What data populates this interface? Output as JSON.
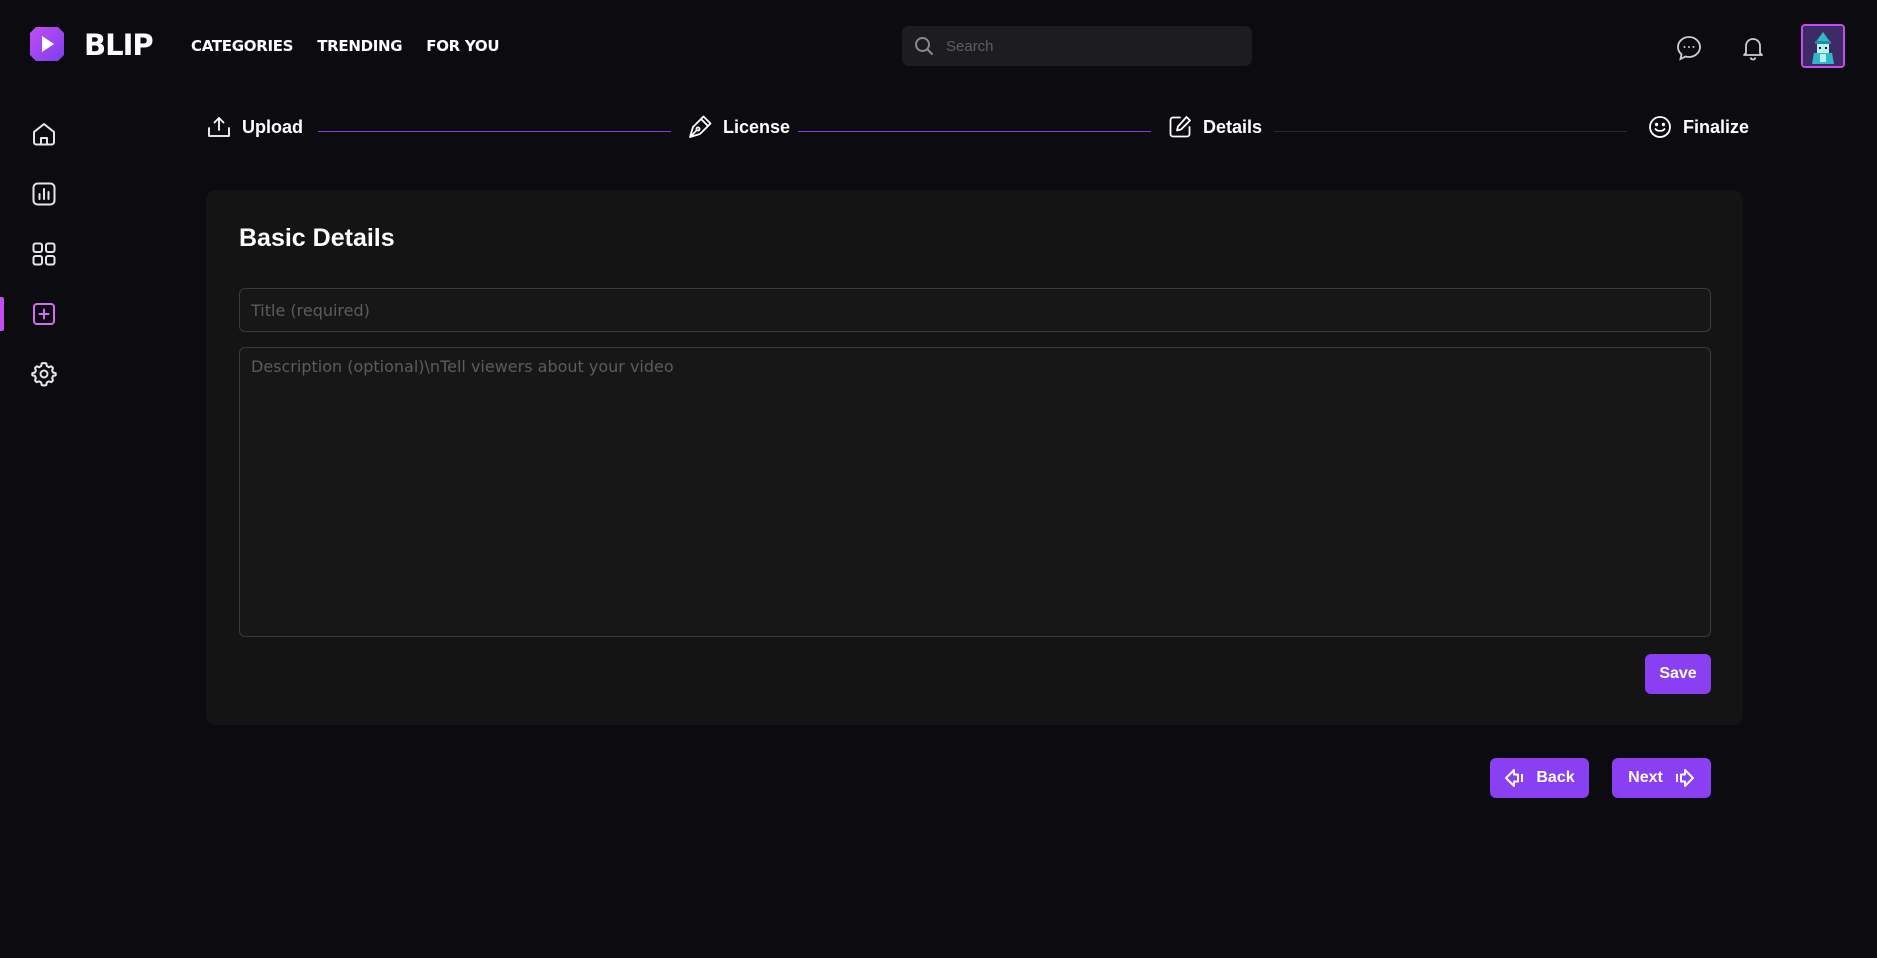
{
  "brand": {
    "name": "BLIP",
    "accent": "#8b3ff2",
    "highlight": "#c44df2"
  },
  "nav": {
    "items": [
      {
        "label": "CATEGORIES"
      },
      {
        "label": "TRENDING"
      },
      {
        "label": "FOR YOU"
      }
    ]
  },
  "search": {
    "placeholder": "Search",
    "icon": "search-icon"
  },
  "header_icons": [
    "chat-icon",
    "bell-icon",
    "avatar"
  ],
  "sidebar": {
    "items": [
      {
        "icon": "home-icon",
        "active": false
      },
      {
        "icon": "analytics-icon",
        "active": false
      },
      {
        "icon": "grid-icon",
        "active": false
      },
      {
        "icon": "plus-square-icon",
        "active": true
      },
      {
        "icon": "settings-icon",
        "active": false
      }
    ]
  },
  "stepper": {
    "steps": [
      {
        "label": "Upload",
        "icon": "upload-icon",
        "completed": true
      },
      {
        "label": "License",
        "icon": "pen-icon",
        "completed": true
      },
      {
        "label": "Details",
        "icon": "edit-icon",
        "completed": false
      },
      {
        "label": "Finalize",
        "icon": "smile-icon",
        "completed": false
      }
    ]
  },
  "form": {
    "heading": "Basic Details",
    "title_placeholder": "Title (required)",
    "description_placeholder": "Description (optional)\\nTell viewers about your video",
    "save_label": "Save"
  },
  "footer_nav": {
    "back_label": "Back",
    "next_label": "Next"
  }
}
